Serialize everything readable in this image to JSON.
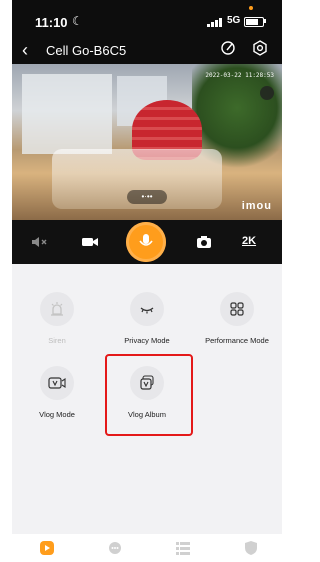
{
  "status_bar": {
    "time": "11:10",
    "network": "5G"
  },
  "header": {
    "title": "Cell Go-B6C5"
  },
  "video": {
    "timestamp": "2022-03-22 11:28:53",
    "watermark": "imou"
  },
  "controls": {
    "resolution": "2K"
  },
  "features": [
    {
      "label": "Siren",
      "icon": "siren-icon",
      "enabled": false
    },
    {
      "label": "Privacy Mode",
      "icon": "closed-eye-icon",
      "enabled": true
    },
    {
      "label": "Performance Mode",
      "icon": "grid-icon",
      "enabled": true
    },
    {
      "label": "Vlog Mode",
      "icon": "vlog-icon",
      "enabled": true
    },
    {
      "label": "Vlog Album",
      "icon": "vlog-album-icon",
      "enabled": true
    }
  ],
  "colors": {
    "accent": "#ff9d1c",
    "highlight": "#e41919",
    "panel": "#f2f2f4"
  }
}
